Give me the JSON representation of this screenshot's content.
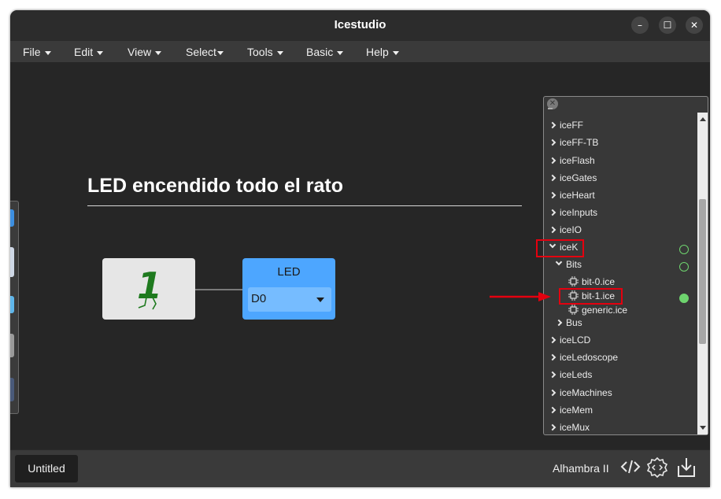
{
  "window": {
    "title": "Icestudio",
    "controls": {
      "minimize": "–",
      "maximize": "☐",
      "close": "✕"
    }
  },
  "menubar": {
    "items": [
      "File",
      "Edit",
      "View",
      "Select",
      "Tools",
      "Basic",
      "Help"
    ]
  },
  "canvas": {
    "diagram_title": "LED encendido todo el rato",
    "constant_block": {
      "value": "1"
    },
    "led_block": {
      "label": "LED",
      "pin": "D0"
    }
  },
  "collections_panel": {
    "items": [
      {
        "label": "iceFF",
        "state": "collapsed"
      },
      {
        "label": "iceFF-TB",
        "state": "collapsed"
      },
      {
        "label": "iceFlash",
        "state": "collapsed"
      },
      {
        "label": "iceGates",
        "state": "collapsed"
      },
      {
        "label": "iceHeart",
        "state": "collapsed"
      },
      {
        "label": "iceInputs",
        "state": "collapsed"
      },
      {
        "label": "iceIO",
        "state": "collapsed"
      },
      {
        "label": "iceK",
        "state": "expanded",
        "highlighted": true
      },
      {
        "label": "Bits",
        "state": "expanded"
      },
      {
        "label": "bit-0.ice",
        "state": "file"
      },
      {
        "label": "bit-1.ice",
        "state": "file",
        "highlighted": true
      },
      {
        "label": "generic.ice",
        "state": "file"
      },
      {
        "label": "Bus",
        "state": "collapsed"
      },
      {
        "label": "iceLCD",
        "state": "collapsed"
      },
      {
        "label": "iceLedoscope",
        "state": "collapsed"
      },
      {
        "label": "iceLeds",
        "state": "collapsed"
      },
      {
        "label": "iceMachines",
        "state": "collapsed"
      },
      {
        "label": "iceMem",
        "state": "collapsed"
      },
      {
        "label": "iceMux",
        "state": "collapsed"
      }
    ]
  },
  "bottombar": {
    "tab_label": "Untitled",
    "board_name": "Alhambra II"
  },
  "colors": {
    "window_bg": "#262626",
    "menubar_bg": "#3a3a3a",
    "led_block": "#4da6ff",
    "constant_block": "#e6e6e6",
    "constant_digit": "#1f7a1f",
    "highlight": "#e4000f",
    "status_green": "#6ed46e"
  },
  "icons": [
    "window-minimize-icon",
    "window-maximize-icon",
    "window-close-icon",
    "chevron-right-icon",
    "chevron-down-icon",
    "chip-icon",
    "code-icon",
    "gear-code-icon",
    "download-icon"
  ]
}
